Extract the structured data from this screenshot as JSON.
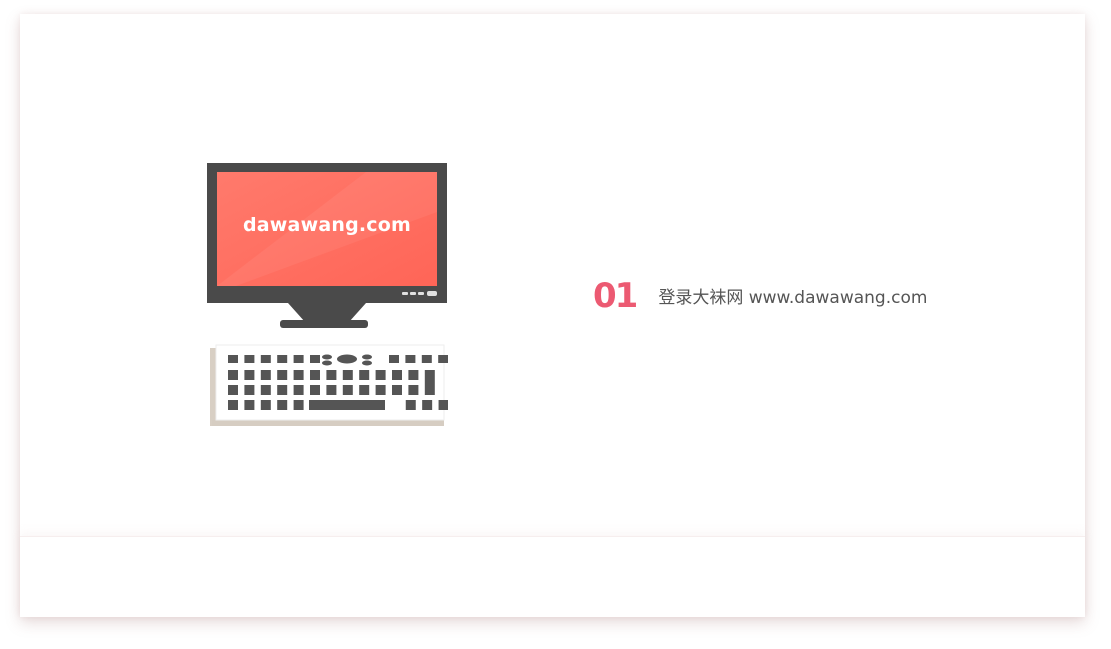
{
  "illustration": {
    "screen_text": "dawawang.com",
    "icon": "desktop-computer-keyboard-icon",
    "screen_color": "#ff6f61",
    "bezel_color": "#4a4a4a"
  },
  "step": {
    "number": "01",
    "text": "登录大袜网 www.dawawang.com",
    "accent_color": "#ec5a72"
  }
}
